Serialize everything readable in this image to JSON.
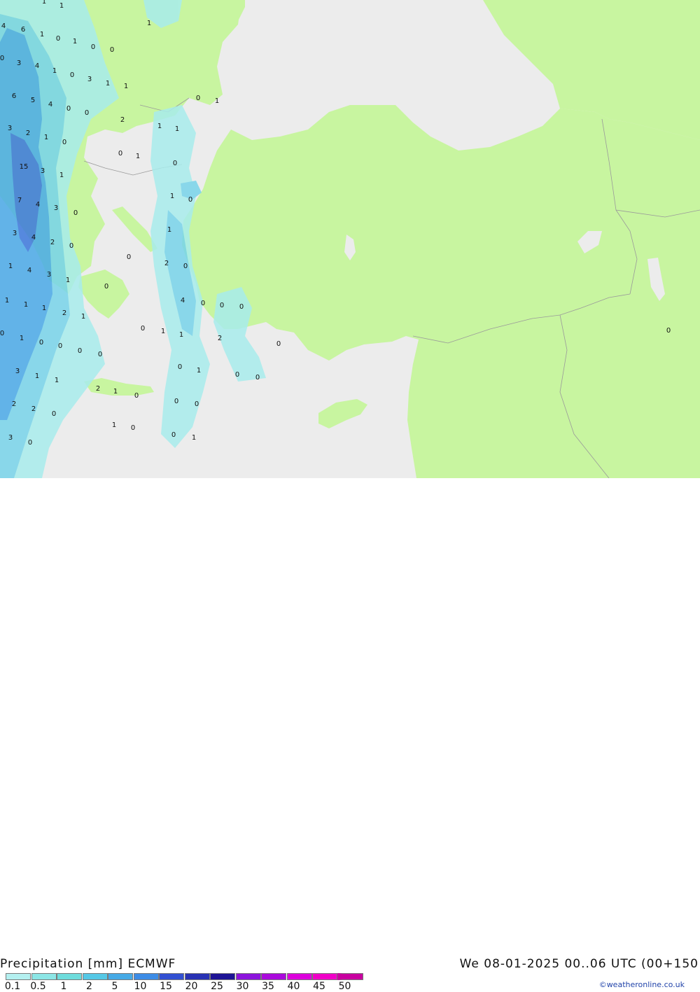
{
  "title_left": "Precipitation [mm] ECMWF",
  "title_right": "We 08-01-2025 00..06 UTC (00+150",
  "credit": "©weatheronline.co.uk",
  "legend": {
    "labels": [
      "0.1",
      "0.5",
      "1",
      "2",
      "5",
      "10",
      "15",
      "20",
      "25",
      "30",
      "35",
      "40",
      "45",
      "50"
    ],
    "colors": [
      "#b4f0f0",
      "#8ce6e6",
      "#6edcdc",
      "#55c8e6",
      "#46aae6",
      "#3c8ce6",
      "#3250d2",
      "#2832b4",
      "#1e1496",
      "#8c14dc",
      "#aa0adc",
      "#dc00dc",
      "#f000c8",
      "#c800a0"
    ]
  },
  "colors": {
    "sea": "#ececec",
    "land": "#c8f5a0",
    "precip_light": "#a8ecec",
    "precip_medium": "#78d4ea",
    "precip_heavy": "#4aaae8",
    "precip_intense": "#3c78dc",
    "border": "#9a9a9a"
  },
  "map_labels": [
    {
      "t": "1"
    },
    {
      "t": "1"
    },
    {
      "t": "4"
    },
    {
      "t": "6"
    },
    {
      "t": "1"
    },
    {
      "t": "0"
    },
    {
      "t": "1"
    },
    {
      "t": "0"
    },
    {
      "t": "0"
    },
    {
      "t": "1"
    },
    {
      "t": "0"
    },
    {
      "t": "3"
    },
    {
      "t": "4"
    },
    {
      "t": "1"
    },
    {
      "t": "0"
    },
    {
      "t": "3"
    },
    {
      "t": "1"
    },
    {
      "t": "1"
    },
    {
      "t": "6"
    },
    {
      "t": "5"
    },
    {
      "t": "4"
    },
    {
      "t": "0"
    },
    {
      "t": "0"
    },
    {
      "t": "0"
    },
    {
      "t": "1"
    },
    {
      "t": "2"
    },
    {
      "t": "3"
    },
    {
      "t": "2"
    },
    {
      "t": "1"
    },
    {
      "t": "0"
    },
    {
      "t": "1"
    },
    {
      "t": "1"
    },
    {
      "t": "0"
    },
    {
      "t": "1"
    },
    {
      "t": "0"
    },
    {
      "t": "15"
    },
    {
      "t": "3"
    },
    {
      "t": "1"
    },
    {
      "t": "7"
    },
    {
      "t": "4"
    },
    {
      "t": "3"
    },
    {
      "t": "0"
    },
    {
      "t": "1"
    },
    {
      "t": "0"
    },
    {
      "t": "3"
    },
    {
      "t": "4"
    },
    {
      "t": "2"
    },
    {
      "t": "0"
    },
    {
      "t": "1"
    },
    {
      "t": "0"
    },
    {
      "t": "1"
    },
    {
      "t": "4"
    },
    {
      "t": "3"
    },
    {
      "t": "2"
    },
    {
      "t": "0"
    },
    {
      "t": "1"
    },
    {
      "t": "0"
    },
    {
      "t": "1"
    },
    {
      "t": "1"
    },
    {
      "t": "1"
    },
    {
      "t": "2"
    },
    {
      "t": "4"
    },
    {
      "t": "0"
    },
    {
      "t": "0"
    },
    {
      "t": "0"
    },
    {
      "t": "1"
    },
    {
      "t": "1"
    },
    {
      "t": "0"
    },
    {
      "t": "1"
    },
    {
      "t": "2"
    },
    {
      "t": "0"
    },
    {
      "t": "0"
    },
    {
      "t": "1"
    },
    {
      "t": "0"
    },
    {
      "t": "0"
    },
    {
      "t": "0"
    },
    {
      "t": "3"
    },
    {
      "t": "1"
    },
    {
      "t": "1"
    },
    {
      "t": "0"
    },
    {
      "t": "1"
    },
    {
      "t": "0"
    },
    {
      "t": "0"
    },
    {
      "t": "2"
    },
    {
      "t": "1"
    },
    {
      "t": "0"
    },
    {
      "t": "0"
    },
    {
      "t": "2"
    },
    {
      "t": "2"
    },
    {
      "t": "0"
    },
    {
      "t": "0"
    },
    {
      "t": "0"
    },
    {
      "t": "1"
    },
    {
      "t": "0"
    },
    {
      "t": "3"
    },
    {
      "t": "0"
    },
    {
      "t": "0"
    },
    {
      "t": "1"
    },
    {
      "t": "0"
    }
  ]
}
